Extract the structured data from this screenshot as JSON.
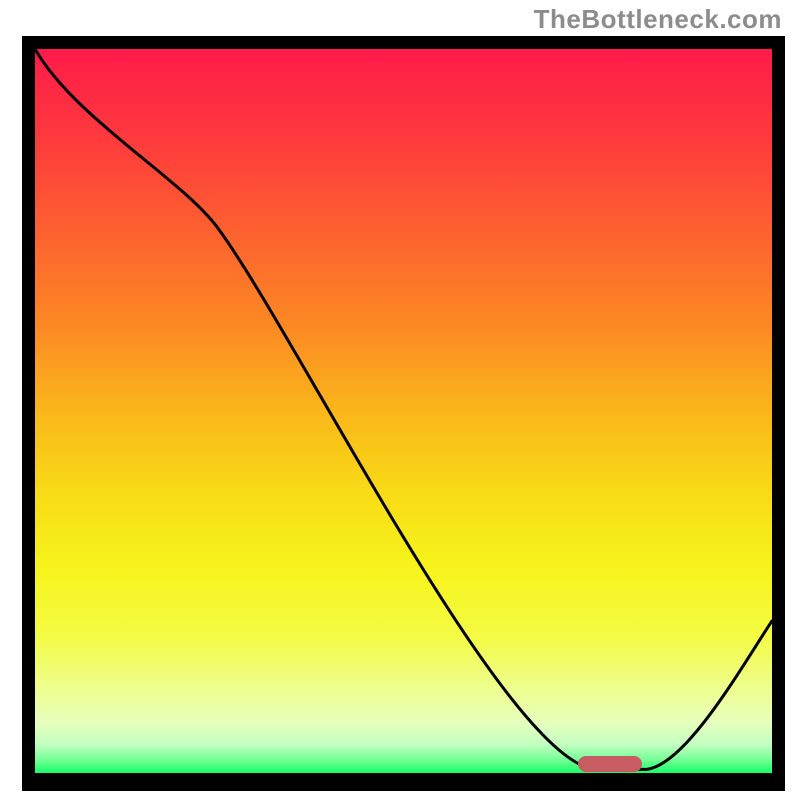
{
  "watermark": "TheBottleneck.com",
  "chart_data": {
    "type": "line",
    "title": "",
    "xlabel": "",
    "ylabel": "",
    "xlim": [
      0,
      100
    ],
    "ylim": [
      0,
      100
    ],
    "grid": false,
    "series": [
      {
        "name": "bottleneck-curve",
        "x": [
          0,
          25,
          76,
          83,
          100
        ],
        "y": [
          100,
          75,
          0.5,
          0.5,
          21
        ],
        "note": "y is approximate percentage height within the gradient area; the curve descends from top-left, inflects near x≈25, reaches a flat minimum around x≈76–83, then rises toward the right edge."
      }
    ],
    "marker": {
      "name": "optimal-range",
      "x_center_pct": 78,
      "y_center_pct": 1.3,
      "color": "#c75c62"
    },
    "gradient_stops": [
      {
        "pct": 0,
        "color": "#fe1b4a"
      },
      {
        "pct": 12,
        "color": "#fe393d"
      },
      {
        "pct": 25,
        "color": "#fd6030"
      },
      {
        "pct": 38,
        "color": "#fc8824"
      },
      {
        "pct": 50,
        "color": "#fab61a"
      },
      {
        "pct": 62,
        "color": "#f8dd16"
      },
      {
        "pct": 72,
        "color": "#f6f41c"
      },
      {
        "pct": 81,
        "color": "#f4fb43"
      },
      {
        "pct": 88,
        "color": "#eefe8a"
      },
      {
        "pct": 93,
        "color": "#e6ffbc"
      },
      {
        "pct": 96,
        "color": "#c3ffc1"
      },
      {
        "pct": 98,
        "color": "#7dff9a"
      },
      {
        "pct": 100,
        "color": "#14ff67"
      }
    ]
  }
}
